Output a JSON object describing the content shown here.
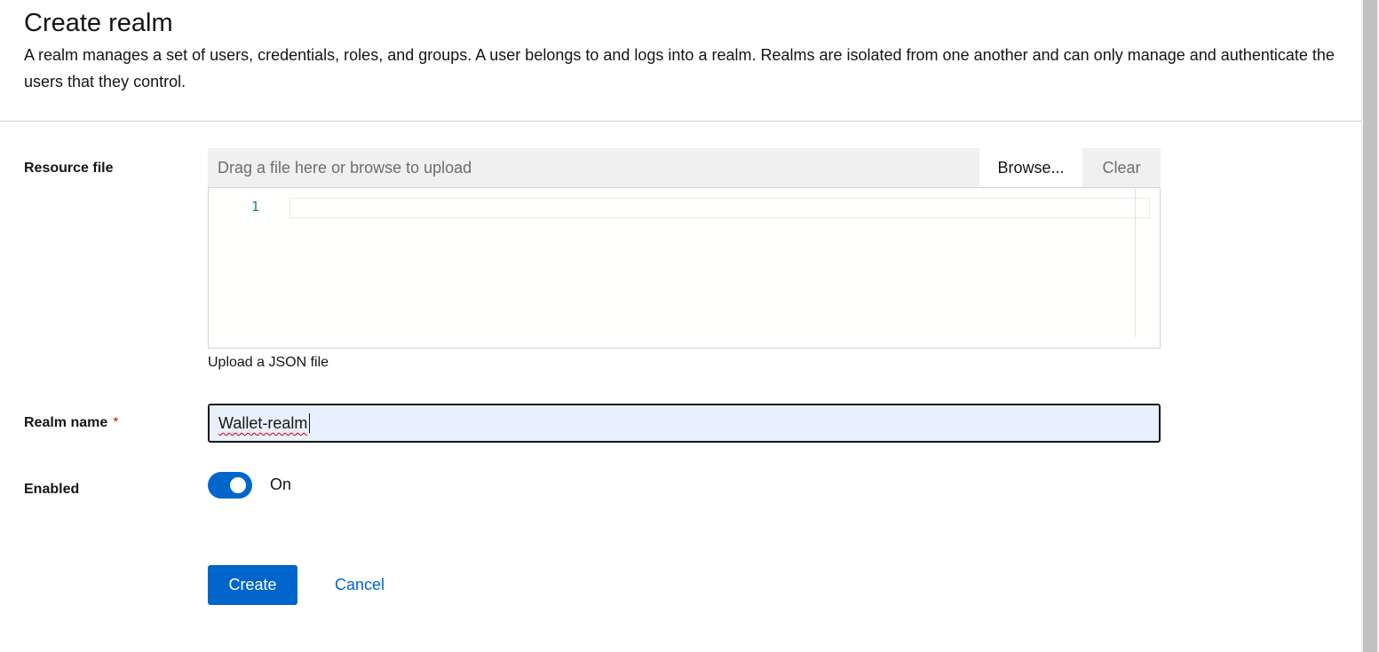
{
  "header": {
    "title": "Create realm",
    "description": "A realm manages a set of users, credentials, roles, and groups. A user belongs to and logs into a realm. Realms are isolated from one another and can only manage and authenticate the users that they control."
  },
  "resource_file": {
    "label": "Resource file",
    "drop_text": "Drag a file here or browse to upload",
    "browse_label": "Browse...",
    "clear_label": "Clear",
    "editor_line_number": "1",
    "helper_text": "Upload a JSON file"
  },
  "realm_name": {
    "label": "Realm name",
    "required_mark": "*",
    "value": "Wallet-realm"
  },
  "enabled": {
    "label": "Enabled",
    "state_label": "On",
    "checked": true
  },
  "actions": {
    "create_label": "Create",
    "cancel_label": "Cancel"
  },
  "colors": {
    "primary": "#0066cc",
    "required": "#c9190b",
    "autofill_bg": "#e8f0fe"
  }
}
